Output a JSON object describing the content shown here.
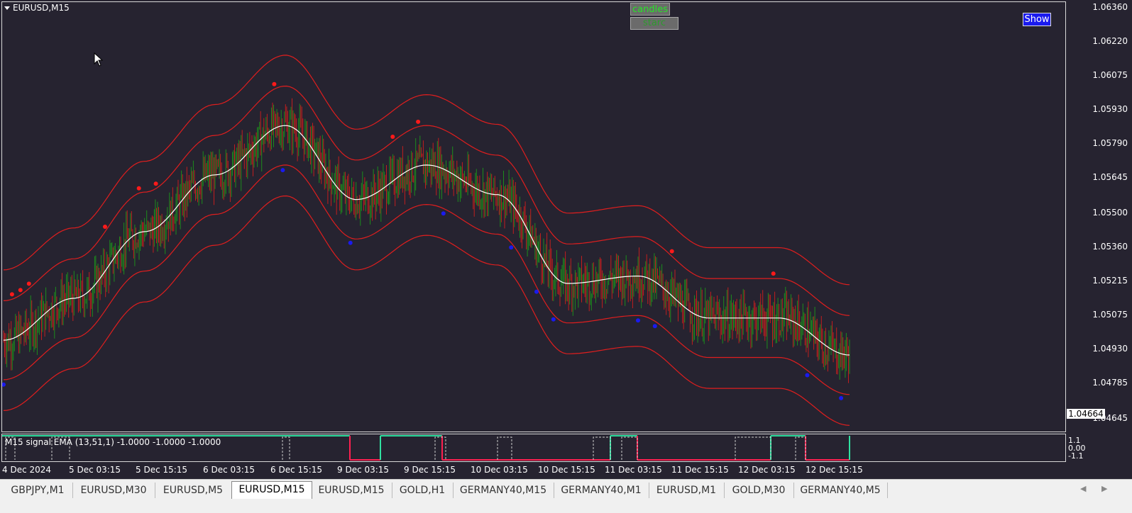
{
  "chart": {
    "symbol_title": "EURUSD,M15",
    "current_price": "1.04664",
    "buttons": {
      "candles": "candles",
      "starc": "starc",
      "show": "Show"
    },
    "price_axis": [
      "1.06360",
      "1.06220",
      "1.06075",
      "1.05930",
      "1.05790",
      "1.05645",
      "1.05500",
      "1.05360",
      "1.05215",
      "1.05075",
      "1.04930",
      "1.04785",
      "1.04645"
    ],
    "time_axis": [
      "4 Dec 2024",
      "5 Dec 03:15",
      "5 Dec 15:15",
      "6 Dec 03:15",
      "6 Dec 15:15",
      "9 Dec 03:15",
      "9 Dec 15:15",
      "10 Dec 03:15",
      "10 Dec 15:15",
      "11 Dec 03:15",
      "11 Dec 15:15",
      "12 Dec 03:15",
      "12 Dec 15:15"
    ],
    "indicator": {
      "label": "M15 signal EMA (13,51,1) -1.0000 -1.0000 -1.0000",
      "ticks": [
        "1.1",
        "0.00",
        "-1.1"
      ]
    },
    "colors": {
      "background": "#262330",
      "bands": "#e01e1e",
      "midline": "#ffffff",
      "bull": "#1c8c1c",
      "bear": "#c01e1e",
      "buy_dot": "#1a1aee",
      "sell_dot": "#ff1a1a",
      "signal_up": "#30e0a0",
      "signal_down": "#ff2050"
    }
  },
  "chart_data": {
    "type": "line",
    "title": "EURUSD,M15",
    "x": [
      "4 Dec 2024",
      "5 Dec 03:15",
      "5 Dec 15:15",
      "6 Dec 03:15",
      "6 Dec 15:15",
      "9 Dec 03:15",
      "9 Dec 15:15",
      "10 Dec 03:15",
      "10 Dec 15:15",
      "11 Dec 03:15",
      "11 Dec 15:15",
      "12 Dec 03:15",
      "12 Dec 15:15"
    ],
    "ylim": [
      1.0464,
      1.0638
    ],
    "series": [
      {
        "values": [
          1.0501,
          1.0518,
          1.0545,
          1.0568,
          1.0588,
          1.0558,
          1.0572,
          1.056,
          1.0524,
          1.0527,
          1.051,
          1.051,
          1.0495
        ]
      }
    ]
  },
  "tabs": [
    {
      "label": "GBPJPY,M1",
      "active": false
    },
    {
      "label": "EURUSD,M30",
      "active": false
    },
    {
      "label": "EURUSD,M5",
      "active": false
    },
    {
      "label": "EURUSD,M15",
      "active": true
    },
    {
      "label": "EURUSD,M15",
      "active": false
    },
    {
      "label": "GOLD,H1",
      "active": false
    },
    {
      "label": "GERMANY40,M15",
      "active": false
    },
    {
      "label": "GERMANY40,M1",
      "active": false
    },
    {
      "label": "EURUSD,M1",
      "active": false
    },
    {
      "label": "GOLD,M30",
      "active": false
    },
    {
      "label": "GERMANY40,M5",
      "active": false
    }
  ],
  "nav": {
    "left_arrow": "◀",
    "right_arrow": "▶"
  }
}
